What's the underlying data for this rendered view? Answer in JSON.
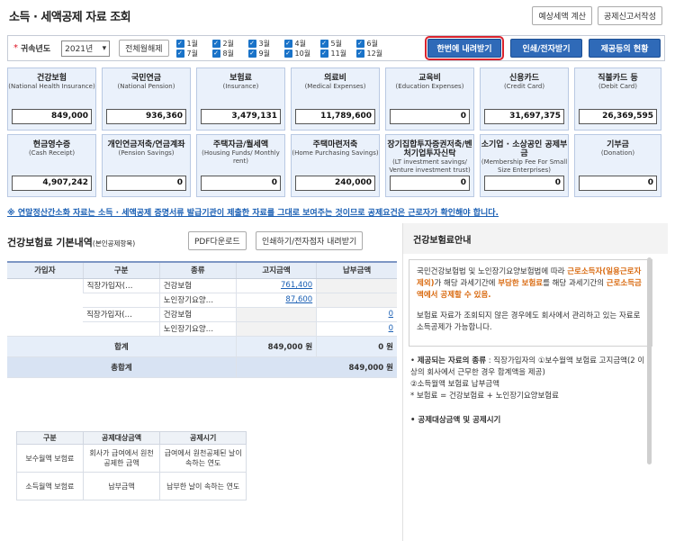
{
  "header": {
    "title": "소득 · 세액공제 자료 조회",
    "btn_estimate": "예상세액 계산",
    "btn_report": "공제신고서작성"
  },
  "filter": {
    "label": "귀속년도",
    "year": "2021년",
    "btn_all_clear": "전체월해제",
    "months": [
      "1월",
      "2월",
      "3월",
      "4월",
      "5월",
      "6월",
      "7월",
      "8월",
      "9월",
      "10월",
      "11월",
      "12월"
    ],
    "btn_download_all": "한번에 내려받기",
    "btn_print": "인쇄/전자받기",
    "btn_status": "제공등의 현황"
  },
  "cards": [
    {
      "name": "건강보험",
      "sub": "(National Health Insurance)",
      "value": "849,000"
    },
    {
      "name": "국민연금",
      "sub": "(National Pension)",
      "value": "936,360"
    },
    {
      "name": "보험료",
      "sub": "(Insurance)",
      "value": "3,479,131"
    },
    {
      "name": "의료비",
      "sub": "(Medical Expenses)",
      "value": "11,789,600"
    },
    {
      "name": "교육비",
      "sub": "(Education Expenses)",
      "value": "0"
    },
    {
      "name": "신용카드",
      "sub": "(Credit Card)",
      "value": "31,697,375"
    },
    {
      "name": "직불카드 등",
      "sub": "(Debit Card)",
      "value": "26,369,595"
    },
    {
      "name": "현금영수증",
      "sub": "(Cash Receipt)",
      "value": "4,907,242"
    },
    {
      "name": "개인연금저축/연금계좌",
      "sub": "(Pension Savings)",
      "value": "0"
    },
    {
      "name": "주택자금/월세액",
      "sub": "(Housing Funds/ Monthly rent)",
      "value": "0"
    },
    {
      "name": "주택마련저축",
      "sub": "(Home Purchasing Savings)",
      "value": "240,000"
    },
    {
      "name": "장기집합투자증권저축/벤처기업투자신탁",
      "sub": "(LT investment savings/ Venture investment trust)",
      "value": "0"
    },
    {
      "name": "소기업 · 소상공인 공제부금",
      "sub": "(Membership Fee For Small Size Enterprises)",
      "value": "0"
    },
    {
      "name": "기부금",
      "sub": "(Donation)",
      "value": "0"
    }
  ],
  "notice": "※ 연말정산간소화 자료는 소득 · 세액공제 증명서류 발급기관이 제출한 자료를 그대로 보여주는 것이므로 공제요건은 근로자가 확인해야 합니다.",
  "detail": {
    "title": "건강보험료 기본내역",
    "title_sub": "(본인공제항목)",
    "btn_pdf": "PDF다운로드",
    "btn_print": "인쇄하기/전자점자 내려받기",
    "columns": [
      "가입자",
      "구분",
      "종류",
      "고지금액",
      "납부금액"
    ],
    "rows": [
      {
        "type": "직장가입자(…",
        "kind": "건강보험",
        "billed": "761,400",
        "paid": ""
      },
      {
        "type": "",
        "kind": "노인장기요양…",
        "billed": "87,600",
        "paid": ""
      },
      {
        "type": "직장가입자(…",
        "kind": "건강보험",
        "billed": "",
        "paid": "0"
      },
      {
        "type": "",
        "kind": "노인장기요양…",
        "billed": "",
        "paid": "0"
      }
    ],
    "sum_label": "합계",
    "sum_billed": "849,000 원",
    "sum_paid": "0 원",
    "total_label": "총합계",
    "total_value": "849,000 원"
  },
  "guide": {
    "title": "건강보험료안내",
    "box_p1_a": "국민건강보험법 및 노인장기요양보험법에 따라 ",
    "box_p1_b": "근로소득자(일용근로자 제외)",
    "box_p1_c": "가 해당 과세기간에 ",
    "box_p1_d": "부담한 보험료",
    "box_p1_e": "를 해당 과세기간의 ",
    "box_p1_f": "근로소득금액에서 공제할 수 있음.",
    "box_p2": "보험료 자료가 조회되지 않은 경우에도 회사에서 관리하고 있는 자료로 소득공제가 가능합니다.",
    "sec1_head": "제공되는 자료의 종류",
    "sec1_body": " : 직장가입자의 ①보수월액 보험료 고지금액(2 이상의 회사에서 근무한 경우 합계액을 제공)",
    "sec1_line2": "②소득월액 보험료 납부금액",
    "sec1_line3": "* 보험료 = 건강보험료 + 노인장기요양보험료",
    "sec2_head": "공제대상금액 및 공제시기",
    "table_cols": [
      "구분",
      "공제대상금액",
      "공제시기"
    ],
    "table_rows": [
      [
        "보수월액 보험료",
        "회사가 급여에서 원천공제한 금액",
        "급여에서 원천공제된 날이 속하는 연도"
      ],
      [
        "소득월액 보험료",
        "납부금액",
        "납부한 날이 속하는 연도"
      ]
    ]
  }
}
